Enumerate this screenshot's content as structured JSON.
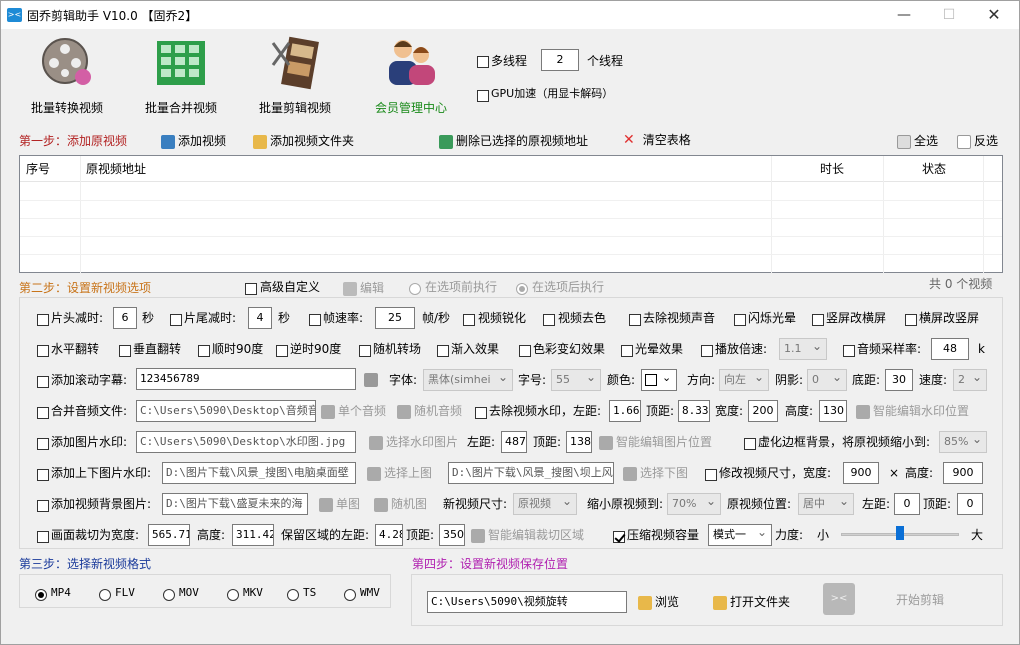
{
  "window": {
    "title": "固乔剪辑助手 V10.0 【固乔2】",
    "minimize": "—",
    "maximize": "☐",
    "close": "✕"
  },
  "toolbar": {
    "batch_convert": "批量转换视频",
    "batch_merge": "批量合并视频",
    "batch_cut": "批量剪辑视频",
    "member_center": "会员管理中心",
    "multithread_label": "多线程",
    "thread_count": "2",
    "thread_suffix": "个线程",
    "gpu_label": "GPU加速（用显卡解码）"
  },
  "step1": {
    "title": "第一步：添加原视频",
    "add_video": "添加视频",
    "add_folder": "添加视频文件夹",
    "delete_selected": "删除已选择的原视频地址",
    "clear_table": "清空表格",
    "select_all": "全选",
    "invert": "反选",
    "columns": [
      "序号",
      "原视频地址",
      "时长",
      "状态"
    ],
    "video_count": "共 0 个视频"
  },
  "step2": {
    "title": "第二步：设置新视频选项",
    "advanced": "高级自定义",
    "edit": "编辑",
    "before_option": "在选项前执行",
    "after_option": "在选项后执行",
    "row1": {
      "head_trim": "片头减时:",
      "head_val": "6",
      "sec1": "秒",
      "tail_trim": "片尾减时:",
      "tail_val": "4",
      "sec2": "秒",
      "fps": "帧速率:",
      "fps_val": "25",
      "fps_unit": "帧/秒",
      "sharpen": "视频锐化",
      "desaturate": "视频去色",
      "remove_audio": "去除视频声音",
      "flash": "闪烁光晕",
      "v2h": "竖屏改横屏",
      "h2v": "横屏改竖屏"
    },
    "row2": {
      "hflip": "水平翻转",
      "vflip": "垂直翻转",
      "cw90": "顺时90度",
      "ccw90": "逆时90度",
      "random_transition": "随机转场",
      "fade_in": "渐入效果",
      "color_shift": "色彩变幻效果",
      "glow": "光晕效果",
      "speed": "播放倍速:",
      "speed_val": "1.1",
      "sample_rate": "音频采样率:",
      "sample_val": "48",
      "sample_unit": "k"
    },
    "row3": {
      "subtitle": "添加滚动字幕:",
      "subtitle_val": "123456789",
      "font": "字体:",
      "font_val": "黑体(simhei",
      "size": "字号:",
      "size_val": "55",
      "color": "颜色:",
      "direction": "方向:",
      "direction_val": "向左",
      "shadow": "阴影:",
      "shadow_val": "0",
      "bottom": "底距:",
      "bottom_val": "30",
      "speed": "速度:",
      "speed_val": "2"
    },
    "row4": {
      "merge_audio": "合并音频文件:",
      "audio_path": "C:\\Users\\5090\\Desktop\\音频音效",
      "single_audio": "单个音频",
      "random_audio": "随机音频",
      "remove_watermark": "去除视频水印，左距:",
      "left_val": "1.666",
      "top": "顶距:",
      "top_val": "8.333",
      "width": "宽度:",
      "width_val": "200",
      "height": "高度:",
      "height_val": "130",
      "smart_wm": "智能编辑水印位置"
    },
    "row5": {
      "image_wm": "添加图片水印:",
      "image_path": "C:\\Users\\5090\\Desktop\\水印图.jpg",
      "choose_wm": "选择水印图片",
      "left": "左距:",
      "left_val": "487",
      "top": "顶距:",
      "top_val": "138",
      "smart_img": "智能编辑图片位置",
      "blur_bg": "虚化边框背景，将原视频缩小到:",
      "blur_val": "85%"
    },
    "row6": {
      "tb_wm": "添加上下图片水印:",
      "top_path": "D:\\图片下载\\风景_搜图\\电脑桌面壁",
      "choose_top": "选择上图",
      "bottom_path": "D:\\图片下载\\风景_搜图\\坝上风",
      "choose_bottom": "选择下图",
      "resize": "修改视频尺寸，宽度:",
      "w_val": "900",
      "x": "×",
      "h_label": "高度:",
      "h_val": "900"
    },
    "row7": {
      "bg_img": "添加视频背景图片:",
      "bg_path": "D:\\图片下载\\盛夏未来的海",
      "single_img": "单图",
      "random_img": "随机图",
      "new_size": "新视频尺寸:",
      "new_size_val": "原视频",
      "shrink": "缩小原视频到:",
      "shrink_val": "70%",
      "pos": "原视频位置:",
      "pos_val": "居中",
      "left": "左距:",
      "left_val": "0",
      "top": "顶距:",
      "top_val": "0"
    },
    "row8": {
      "crop": "画面裁切为宽度:",
      "crop_w": "565.714",
      "crop_h_label": "高度:",
      "crop_h": "311.428",
      "keep_left": "保留区域的左距:",
      "keep_left_val": "4.28",
      "top": "顶距:",
      "top_val": "350",
      "smart_crop": "智能编辑裁切区域",
      "compress": "压缩视频容量",
      "mode_val": "模式一",
      "strength": "力度:",
      "small": "小",
      "large": "大",
      "strength_level": 0.5
    }
  },
  "step3": {
    "title": "第三步：选择新视频格式",
    "formats": [
      "MP4",
      "FLV",
      "MOV",
      "MKV",
      "TS",
      "WMV"
    ]
  },
  "step4": {
    "title": "第四步：设置新视频保存位置",
    "path": "C:\\Users\\5090\\视频旋转",
    "browse": "浏览",
    "open_folder": "打开文件夹",
    "start": "开始剪辑"
  }
}
